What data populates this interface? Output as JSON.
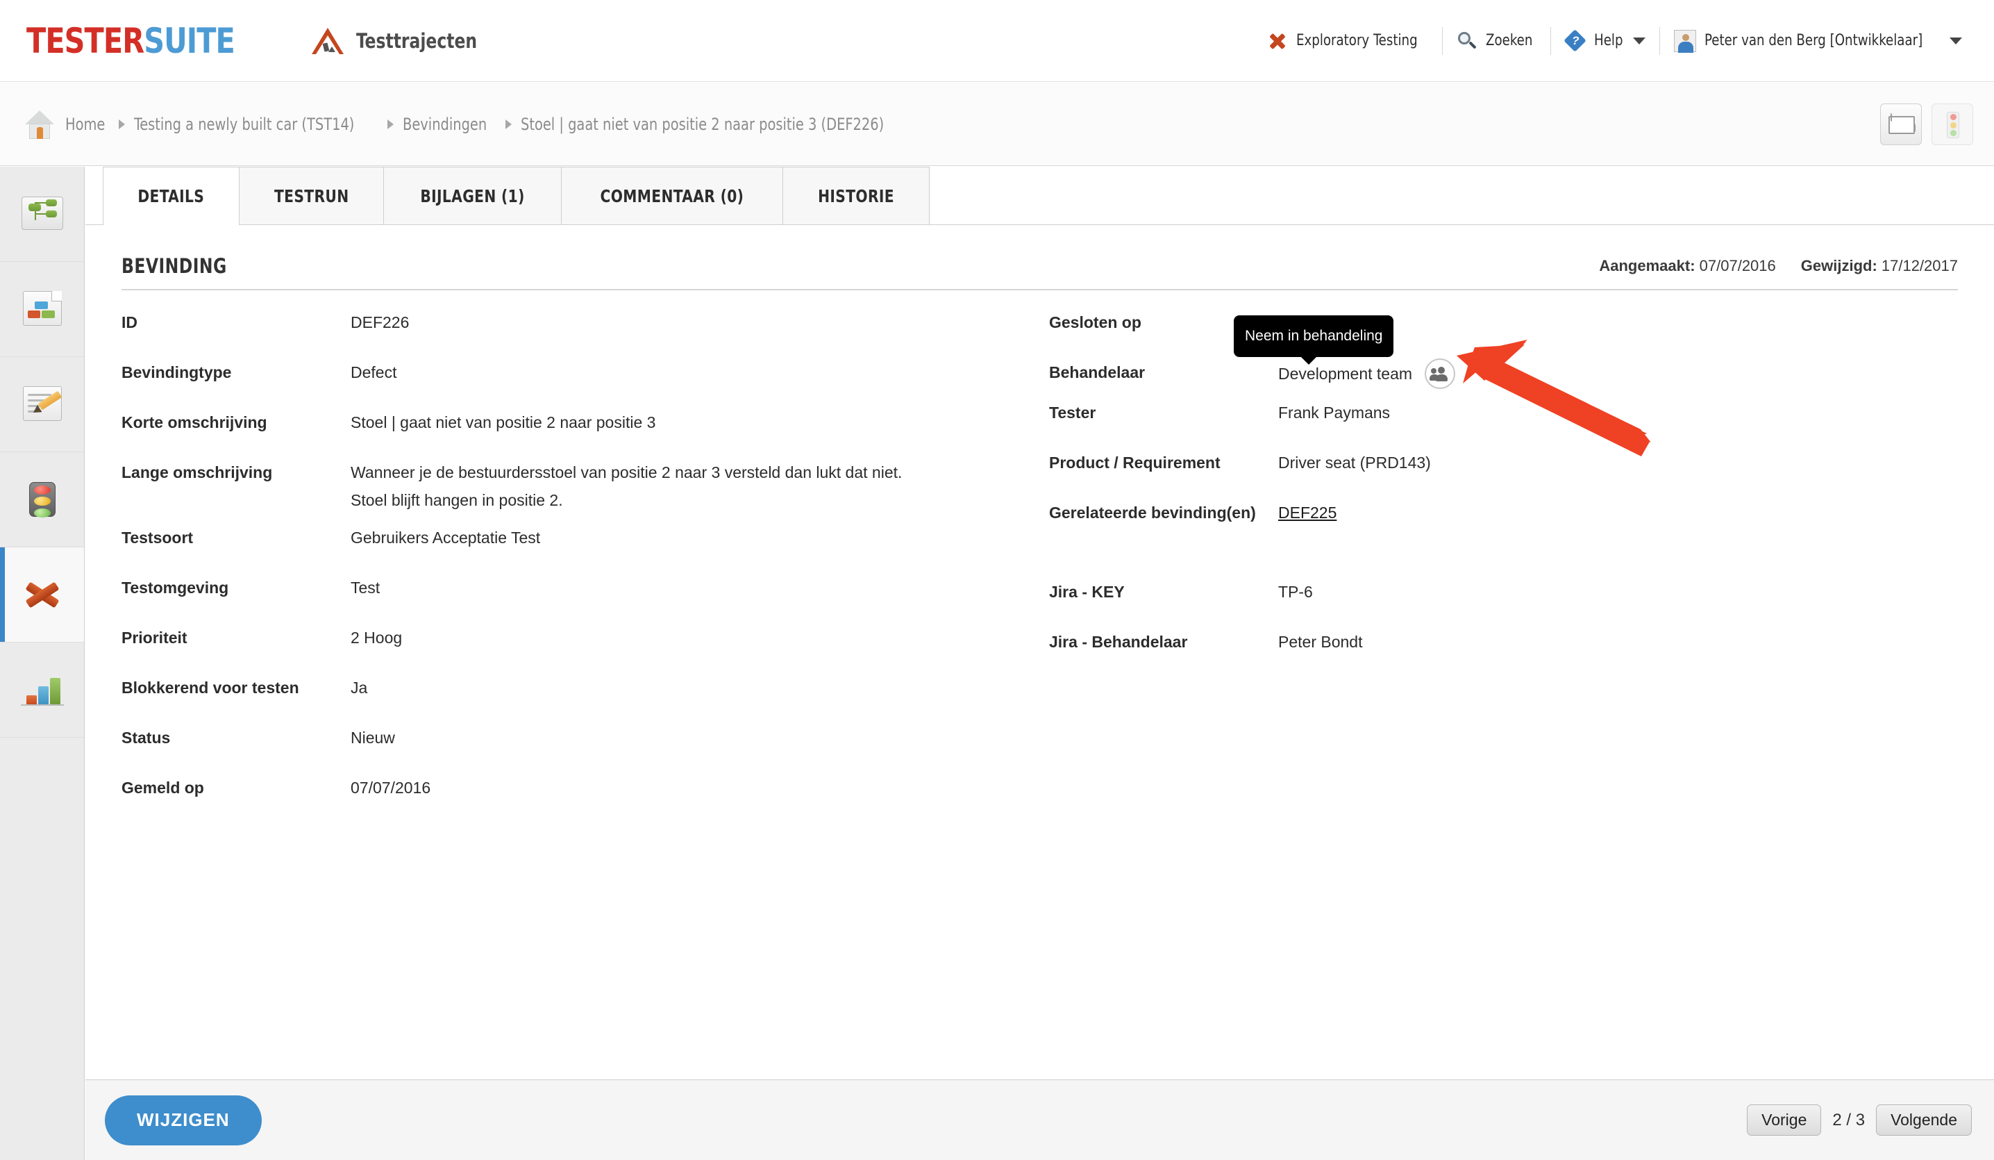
{
  "app": {
    "logo_part1": "TESTER",
    "logo_part2": "SUITE",
    "module_title": "Testtrajecten"
  },
  "topnav": {
    "exploratory_testing": "Exploratory Testing",
    "search": "Zoeken",
    "help": "Help",
    "user": "Peter van den Berg [Ontwikkelaar]"
  },
  "breadcrumb": {
    "home": "Home",
    "project": "Testing a newly built car (TST14)",
    "section": "Bevindingen",
    "current": "Stoel | gaat niet van positie 2 naar positie 3 (DEF226)"
  },
  "sidebar": {
    "items": [
      {
        "name": "structuur",
        "icon": "tree-icon"
      },
      {
        "name": "testgevallen",
        "icon": "document-blocks-icon"
      },
      {
        "name": "testontwerp",
        "icon": "document-pencil-icon"
      },
      {
        "name": "testrun",
        "icon": "traffic-light-icon"
      },
      {
        "name": "bevindingen",
        "icon": "x-mark-icon",
        "active": true
      },
      {
        "name": "rapportage",
        "icon": "bar-chart-icon"
      }
    ]
  },
  "tabs": [
    {
      "label": "DETAILS",
      "active": true
    },
    {
      "label": "TESTRUN",
      "active": false
    },
    {
      "label": "BIJLAGEN (1)",
      "active": false
    },
    {
      "label": "COMMENTAAR (0)",
      "active": false
    },
    {
      "label": "HISTORIE",
      "active": false
    }
  ],
  "panel": {
    "title": "BEVINDING",
    "created_label": "Aangemaakt:",
    "created_value": "07/07/2016",
    "modified_label": "Gewijzigd:",
    "modified_value": "17/12/2017"
  },
  "left_fields": {
    "id_label": "ID",
    "id_value": "DEF226",
    "type_label": "Bevindingtype",
    "type_value": "Defect",
    "short_label": "Korte omschrijving",
    "short_value": "Stoel | gaat niet van positie 2 naar positie 3",
    "long_label": "Lange omschrijving",
    "long_value_line1": "Wanneer je de bestuurdersstoel van positie 2 naar 3 versteld dan lukt dat niet.",
    "long_value_line2": "Stoel blijft hangen in positie 2.",
    "testsoort_label": "Testsoort",
    "testsoort_value": "Gebruikers Acceptatie Test",
    "env_label": "Testomgeving",
    "env_value": "Test",
    "priority_label": "Prioriteit",
    "priority_value": "2 Hoog",
    "blocking_label": "Blokkerend voor testen",
    "blocking_value": "Ja",
    "status_label": "Status",
    "status_value": "Nieuw",
    "reported_label": "Gemeld op",
    "reported_value": "07/07/2016"
  },
  "right_fields": {
    "closed_label": "Gesloten op",
    "closed_value": "-",
    "assignee_label": "Behandelaar",
    "assignee_value": "Development team",
    "assignee_tooltip": "Neem in behandeling",
    "tester_label": "Tester",
    "tester_value": "Frank Paymans",
    "product_label": "Product / Requirement",
    "product_value": "Driver seat (PRD143)",
    "related_label": "Gerelateerde bevinding(en)",
    "related_value": "DEF225",
    "jira_key_label": "Jira - KEY",
    "jira_key_value": "TP-6",
    "jira_assignee_label": "Jira - Behandelaar",
    "jira_assignee_value": "Peter Bondt"
  },
  "footer": {
    "edit_button": "WIJZIGEN",
    "prev_button": "Vorige",
    "page_counter": "2 / 3",
    "next_button": "Volgende"
  },
  "colors": {
    "brand_red": "#d32f27",
    "brand_blue": "#4d9bd4",
    "accent_button": "#3e8dcc",
    "annotation_arrow": "#ef4123",
    "active_tab_marker": "#3a86c8"
  }
}
